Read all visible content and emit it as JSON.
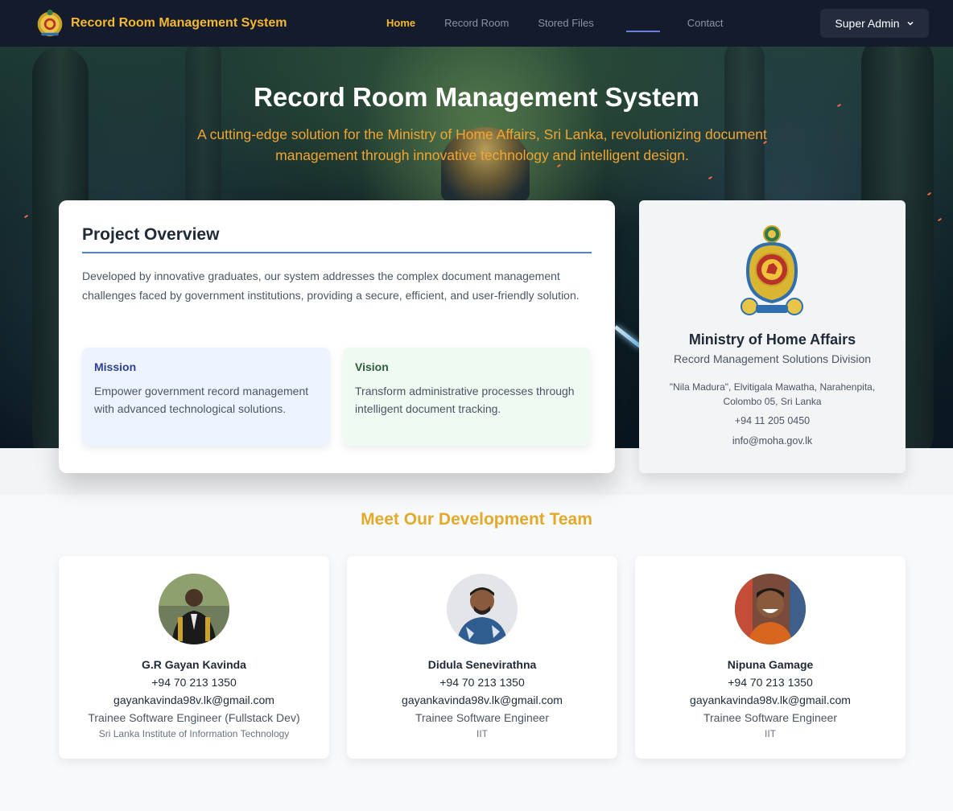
{
  "nav": {
    "brand": "Record Room Management System",
    "links": [
      "Home",
      "Record Room",
      "Stored Files",
      "",
      "Contact"
    ],
    "user": "Super Admin"
  },
  "hero": {
    "title": "Record Room Management System",
    "subtitle": "A cutting-edge solution for the Ministry of Home Affairs, Sri Lanka, revolutionizing document management through innovative technology and intelligent design."
  },
  "overview": {
    "title": "Project Overview",
    "text": "Developed by innovative graduates, our system addresses the complex document management challenges faced by government institutions, providing a secure, efficient, and user-friendly solution.",
    "mission": {
      "heading": "Mission",
      "body": "Empower government record management with advanced technological solutions."
    },
    "vision": {
      "heading": "Vision",
      "body": "Transform administrative processes through intelligent document tracking."
    }
  },
  "ministry": {
    "name": "Ministry of Home Affairs",
    "division": "Record Management Solutions Division",
    "address": "\"Nila Madura\", Elvitigala Mawatha, Narahenpita, Colombo 05, Sri Lanka",
    "phone": "+94 11 205 0450",
    "email": "info@moha.gov.lk"
  },
  "team": {
    "title": "Meet Our Development Team",
    "members": [
      {
        "name": "G.R Gayan Kavinda",
        "phone": "+94 70 213 1350",
        "email": "gayankavinda98v.lk@gmail.com",
        "role": "Trainee Software Engineer (Fullstack Dev)",
        "org": "Sri Lanka Institute of Information Technology"
      },
      {
        "name": "Didula Senevirathna",
        "phone": "+94 70 213 1350",
        "email": "gayankavinda98v.lk@gmail.com",
        "role": "Trainee Software Engineer",
        "org": "IIT"
      },
      {
        "name": "Nipuna Gamage",
        "phone": "+94 70 213 1350",
        "email": "gayankavinda98v.lk@gmail.com",
        "role": "Trainee Software Engineer",
        "org": "IIT"
      }
    ]
  },
  "colors": {
    "nav_bg": "#141b2d",
    "brand_gold": "#f5b82e",
    "hero_subtitle": "#f2a533",
    "rule_blue": "#4a84e0"
  },
  "icons": [
    "national-emblem-icon",
    "chevron-down-icon"
  ]
}
